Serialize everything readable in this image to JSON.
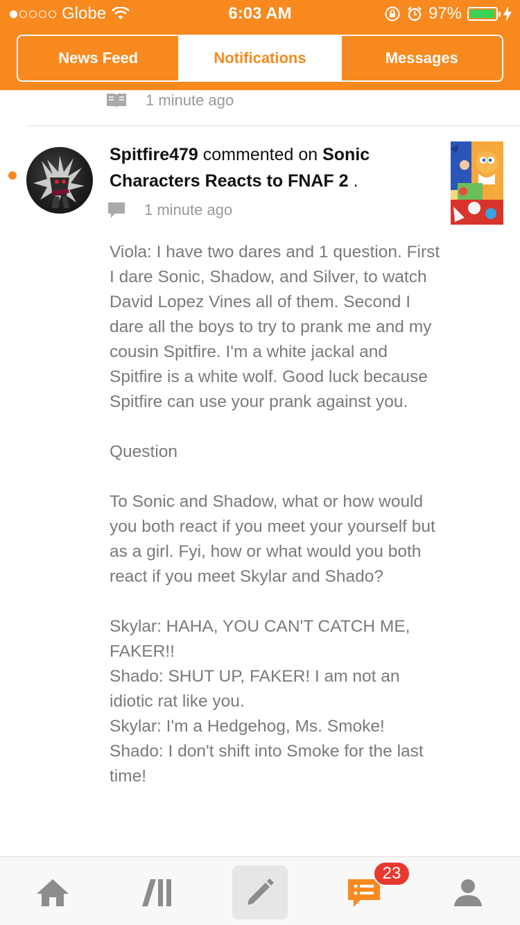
{
  "status_bar": {
    "carrier": "Globe",
    "signal_dots": [
      true,
      false,
      false,
      false,
      false
    ],
    "time": "6:03 AM",
    "battery_percent": "97%",
    "battery_level": 0.97
  },
  "tabs": [
    {
      "label": "News Feed",
      "active": false
    },
    {
      "label": "Notifications",
      "active": true
    },
    {
      "label": "Messages",
      "active": false
    }
  ],
  "previous_notification": {
    "icon": "book-icon",
    "time": "1 minute ago"
  },
  "notification": {
    "user": "Spitfire479",
    "action": " commented on ",
    "story": "Sonic Characters Reacts to FNAF 2",
    "suffix": " .",
    "icon": "comment-icon",
    "time": "1 minute ago",
    "unread": true,
    "comment": "Viola: I have two dares and 1 question. First I dare Sonic, Shadow, and Silver, to watch David Lopez Vines all of them. Second I dare all the boys to try to prank me and my cousin Spitfire. I'm a white jackal and Spitfire is a white wolf. Good luck because Spitfire can use your prank against you.\n\nQuestion\n\nTo Sonic and Shadow, what or how would you both react if you meet your yourself but as a girl. Fyi, how or what would you both react if you meet Skylar and Shado?\n\nSkylar: HAHA, YOU CAN'T CATCH ME, FAKER!!\nShado: SHUT UP, FAKER! I am not an idiotic rat like you.\nSkylar: I'm a Hedgehog, Ms. Smoke!\nShado: I don't shift into Smoke for the last time!"
  },
  "bottom_nav": {
    "items": [
      "home-icon",
      "library-icon",
      "write-icon",
      "notifications-icon",
      "profile-icon"
    ],
    "selected": "write-icon",
    "badge_count": "23"
  },
  "colors": {
    "accent": "#f7891f",
    "badge": "#e8392f",
    "meta_text": "#999999",
    "comment_text": "#7a7a7a"
  }
}
